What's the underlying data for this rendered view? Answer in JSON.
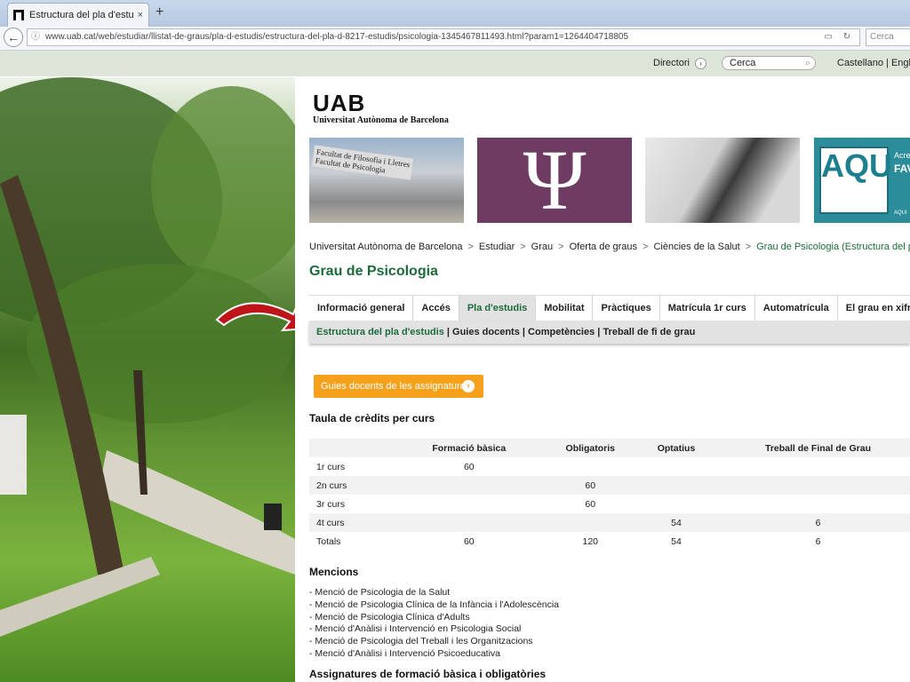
{
  "browser": {
    "tab_title": "Estructura del pla d'estudis: G",
    "tab_close": "×",
    "new_tab": "+",
    "back": "←",
    "info_icon": "ⓘ",
    "url": "www.uab.cat/web/estudiar/llistat-de-graus/pla-d-estudis/estructura-del-pla-d-8217-estudis/psicologia-1345467811493.html?param1=1264404718805",
    "reader_icon": "▭",
    "reload_icon": "↻",
    "search_placeholder": "Cerca",
    "search_icon": "🔍"
  },
  "topbar": {
    "directori": "Directori",
    "directori_arrow": "›",
    "search_value": "Cerca",
    "search_icon": "⌕",
    "languages": "Castellano | English"
  },
  "logo": {
    "mark": "UAB",
    "name": "Universitat Autònoma de Barcelona"
  },
  "banners": {
    "building_sign": "Facultat de Filosofia i Lletres\nFacultat de Psicologia",
    "psi": "Ψ",
    "aqu_logo": "AQU",
    "aqu_acr": "Acre",
    "aqu_fav": "FAV",
    "aqu_small": "AQUI"
  },
  "breadcrumb": [
    "Universitat Autònoma de Barcelona",
    "Estudiar",
    "Grau",
    "Oferta de graus",
    "Ciències de la Salut",
    "Grau de Psicologia (Estructura del pla d'estudis)"
  ],
  "breadcrumb_sep": ">",
  "page_title": "Grau de Psicologia",
  "tabs": [
    "Informació general",
    "Accés",
    "Pla d'estudis",
    "Mobilitat",
    "Pràctiques",
    "Matrícula 1r curs",
    "Automatrícula",
    "El grau en xifres"
  ],
  "subnav": {
    "current": "Estructura del pla d'estudis",
    "items": [
      "Guies docents",
      "Competències",
      "Treball de fi de grau"
    ],
    "sep": " | "
  },
  "guides_button": "Guies docents de les assignatures",
  "guides_button_icon": "›",
  "credits": {
    "heading": "Taula de crèdits per curs",
    "columns": [
      "",
      "Formació bàsica",
      "Obligatoris",
      "Optatius",
      "Treball de Final de Grau"
    ],
    "rows": [
      [
        "1r curs",
        "60",
        "",
        "",
        ""
      ],
      [
        "2n curs",
        "",
        "60",
        "",
        ""
      ],
      [
        "3r curs",
        "",
        "60",
        "",
        ""
      ],
      [
        "4t curs",
        "",
        "",
        "54",
        "6"
      ],
      [
        "Totals",
        "60",
        "120",
        "54",
        "6"
      ]
    ]
  },
  "mencions": {
    "heading": "Mencions",
    "items": [
      "- Menció de Psicologia de la Salut",
      "- Menció de Psicologia Clínica de la Infància i l'Adolescència",
      "- Menció de Psicologia Clínica d'Adults",
      "- Menció d'Anàlisi i Intervenció en Psicologia Social",
      "- Menció de Psicologia del Treball i les Organitzacions",
      "- Menció d'Anàlisi i Intervenció Psicoeducativa"
    ]
  },
  "next_heading": "Assignatures de formació bàsica i obligatòries",
  "colors": {
    "accent_green": "#1c6b3a",
    "orange": "#f5a11c",
    "psi_purple": "#6e3b63",
    "arrow_red": "#c0141b"
  }
}
